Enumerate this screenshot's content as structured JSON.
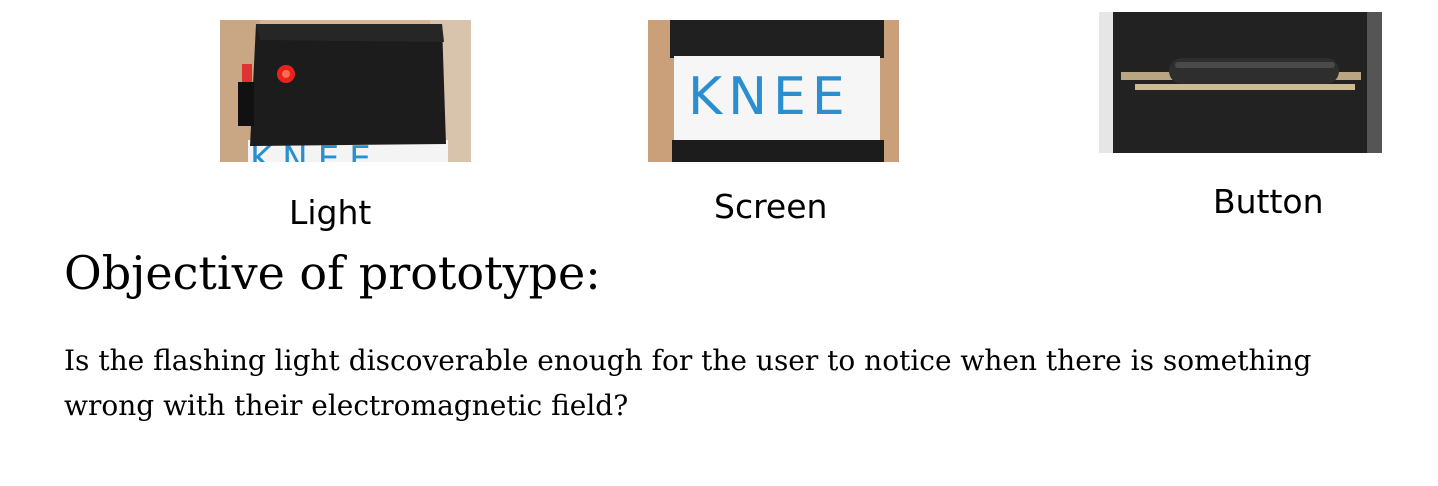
{
  "figures": [
    {
      "caption": "Light",
      "photo_icon": "wrist-device-light-photo"
    },
    {
      "caption": "Screen",
      "photo_icon": "knee-screen-photo",
      "photo_text": "KNEE"
    },
    {
      "caption": "Button",
      "photo_icon": "device-button-photo"
    }
  ],
  "heading": "Objective of prototype:",
  "body": "Is the flashing light discoverable enough for the user to notice when there is something wrong with their electromagnetic field?",
  "colors": {
    "device_black": "#1a1a1a",
    "light_red": "#e8231c",
    "marker_blue": "#2a8fd0",
    "skin": "#d9b99a"
  }
}
